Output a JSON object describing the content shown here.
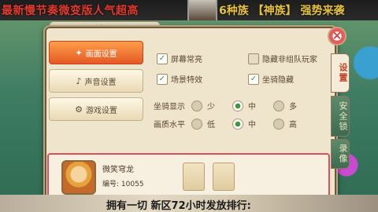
{
  "banner": {
    "left_text": "最新慢节奏微变版人气超高",
    "right_text": "6种族 【神族】 强势来袭"
  },
  "bottom_banner": "拥有一切 新区72小时发放排行:",
  "panel": {
    "title": "设置",
    "close_label": "×",
    "menu": [
      {
        "label": "画面设置",
        "icon": "✦",
        "active": true
      },
      {
        "label": "声音设置",
        "icon": "♪",
        "active": false
      },
      {
        "label": "游戏设置",
        "icon": "⚙",
        "active": false
      }
    ],
    "right_tabs": [
      {
        "label": "设置",
        "active": true
      },
      {
        "label": "安全锁",
        "active": false
      },
      {
        "label": "录像",
        "active": false
      }
    ],
    "checkboxes": [
      {
        "label": "屏幕常亮",
        "checked": true
      },
      {
        "label": "隐藏非组队玩家",
        "checked": false
      },
      {
        "label": "场景特效",
        "checked": true
      },
      {
        "label": "坐骑隐藏",
        "checked": true
      }
    ],
    "rows": [
      {
        "label": "坐骑显示",
        "options": [
          "少",
          "中",
          "多"
        ],
        "selected": 1
      },
      {
        "label": "画质水平",
        "options": [
          "低",
          "中",
          "高"
        ],
        "selected": 1
      }
    ]
  },
  "player": {
    "name": "微笑穹龙",
    "id_label": "编号:",
    "id_value": "10055"
  }
}
